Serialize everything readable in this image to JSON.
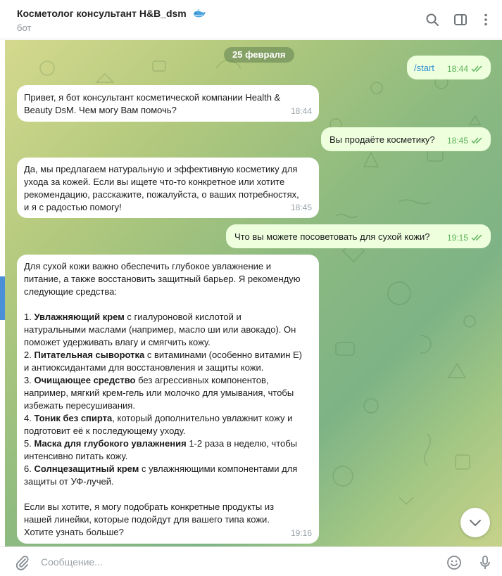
{
  "header": {
    "title": "Косметолог консультант H&B_dsm",
    "subtitle": "бот",
    "title_icon": "whale-emoji"
  },
  "chat": {
    "date_label": "25 февраля",
    "messages": [
      {
        "direction": "out",
        "text": "/start",
        "time": "18:44",
        "status": "read"
      },
      {
        "direction": "in",
        "text": "Привет, я бот консультант косметической компании Health &\nBeauty DsM. Чем могу Вам помочь?",
        "time": "18:44"
      },
      {
        "direction": "out",
        "text": "Вы продаёте косметику?",
        "time": "18:45",
        "status": "read"
      },
      {
        "direction": "in",
        "text": "Да, мы предлагаем натуральную и эффективную косметику для\nухода за кожей. Если вы ищете что-то конкретное или хотите\nрекомендацию, расскажите, пожалуйста, о ваших потребностях,\nи я с радостью помогу!",
        "time": "18:45"
      },
      {
        "direction": "out",
        "text": "Что вы можете посоветовать для сухой кожи?",
        "time": "19:15",
        "status": "read"
      },
      {
        "direction": "in",
        "time": "19:16",
        "intro": "Для сухой кожи важно обеспечить глубокое увлажнение и\nпитание, а также восстановить защитный барьер. Я рекомендую\nследующие средства:",
        "items": [
          {
            "num": "1. ",
            "bold": "Увлажняющий крем",
            "rest": " с гиалуроновой кислотой и\nнатуральными маслами (например, масло ши или авокадо). Он\nпоможет удерживать влагу и смягчить кожу."
          },
          {
            "num": "2. ",
            "bold": "Питательная сыворотка",
            "rest": " с витаминами (особенно витамин E)\nи антиоксидантами для восстановления и защиты кожи."
          },
          {
            "num": "3. ",
            "bold": "Очищающее средство",
            "rest": " без агрессивных компонентов,\nнапример, мягкий крем-гель или молочко для умывания, чтобы\nизбежать пересушивания."
          },
          {
            "num": "4. ",
            "bold": "Тоник без спирта",
            "rest": ", который дополнительно увлажнит кожу и\nподготовит её к последующему уходу."
          },
          {
            "num": "5. ",
            "bold": "Маска для глубокого увлажнения",
            "rest": " 1-2 раза в неделю, чтобы\nинтенсивно питать кожу."
          },
          {
            "num": "6. ",
            "bold": "Солнцезащитный крем",
            "rest": " с увлажняющими компонентами для\nзащиты от УФ-лучей."
          }
        ],
        "outro": "Если вы хотите, я могу подобрать конкретные продукты из\nнашей линейки, которые подойдут для вашего типа кожи.\nХотите узнать больше?"
      }
    ]
  },
  "composer": {
    "placeholder": "Сообщение...",
    "value": ""
  },
  "icons": {
    "search": "search-icon",
    "sidebar": "sidebar-toggle-icon",
    "menu": "more-vertical-icon",
    "attach": "paperclip-icon",
    "emoji": "smiley-icon",
    "mic": "microphone-icon",
    "scroll": "chevron-down-icon"
  },
  "colors": {
    "incoming_bubble": "#ffffff",
    "outgoing_bubble": "#eeffde",
    "accent": "#5db35a",
    "link": "#2e8fd1"
  }
}
